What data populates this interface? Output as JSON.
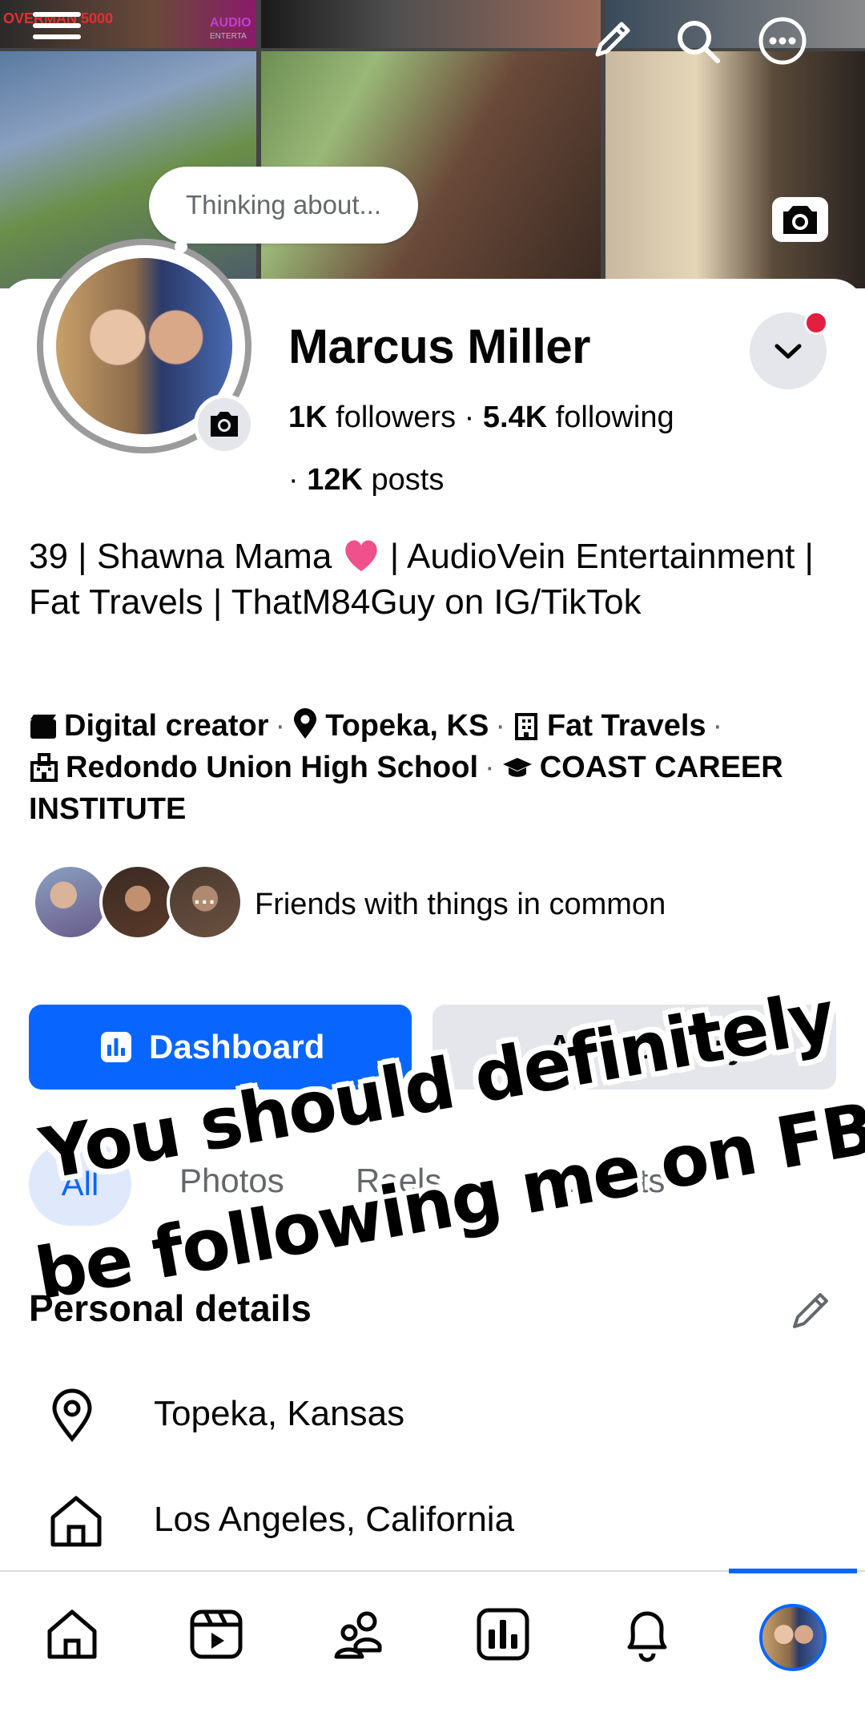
{
  "cover": {
    "tile_text_1": "OVERMAN 5000",
    "tile_text_2": "AUDIO",
    "tile_text_3": "ENTERTA"
  },
  "thought_bubble": "Thinking about...",
  "profile": {
    "name": "Marcus Miller",
    "followers_count": "1K",
    "followers_label": "followers",
    "following_count": "5.4K",
    "following_label": "following",
    "posts_count": "12K",
    "posts_label": "posts",
    "separator": " · "
  },
  "bio": {
    "part1": "39 | Shawna Mama ",
    "part2": " | AudioVein Entertainment | Fat Travels | ThatM84Guy on IG/TikTok"
  },
  "intro": {
    "category": "Digital creator",
    "location": "Topeka, KS",
    "workplace": "Fat Travels",
    "high_school": "Redondo Union High School",
    "college": "COAST CAREER INSTITUTE",
    "dot": "·"
  },
  "mutual_friends": {
    "more_glyph": "···",
    "label": "Friends with things in common"
  },
  "buttons": {
    "dashboard": "Dashboard",
    "add_to_story": "Add to story"
  },
  "tabs": {
    "all": "All",
    "photos": "Photos",
    "reels": "Reels",
    "events": "Events"
  },
  "caption_overlay": {
    "line1": "You should definitely",
    "line2": "be following me on FB"
  },
  "personal_details": {
    "title": "Personal details",
    "items": [
      {
        "icon": "location-pin-icon",
        "text": "Topeka, Kansas"
      },
      {
        "icon": "home-icon",
        "text": "Los Angeles, California"
      }
    ]
  },
  "bottom_nav": [
    "home-icon",
    "video-icon",
    "friends-icon",
    "dashboard-icon",
    "bell-icon",
    "profile-avatar"
  ],
  "colors": {
    "accent": "#0866ff",
    "notification": "#e41e3f",
    "secondary_text": "#65676b"
  }
}
